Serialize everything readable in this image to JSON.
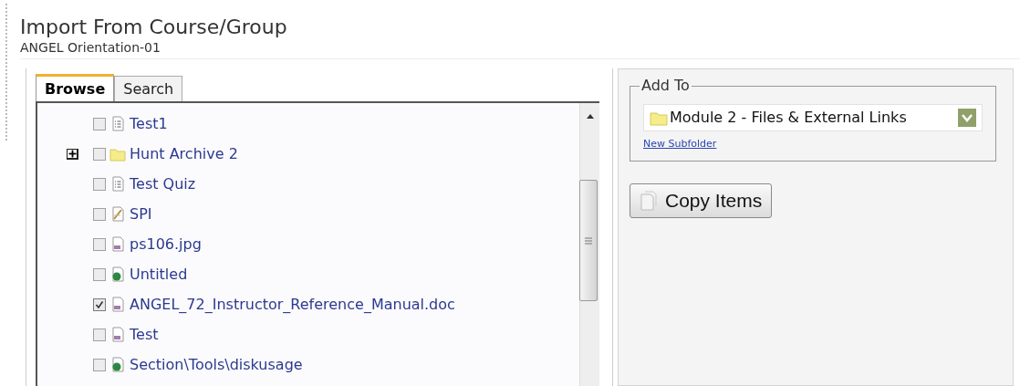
{
  "header": {
    "title": "Import From Course/Group",
    "subtitle": "ANGEL Orientation-01"
  },
  "tabs": [
    {
      "label": "Browse",
      "selected": true
    },
    {
      "label": "Search",
      "selected": false
    }
  ],
  "tree": {
    "items": [
      {
        "label": "Test1",
        "kind": "quiz",
        "checked": false
      },
      {
        "label": "Hunt Archive 2",
        "kind": "folder",
        "checked": false,
        "expanded": false
      },
      {
        "label": "Test Quiz",
        "kind": "quiz",
        "checked": false
      },
      {
        "label": "SPI",
        "kind": "assignment",
        "checked": false
      },
      {
        "label": "ps106.jpg",
        "kind": "file",
        "checked": false
      },
      {
        "label": "Untitled",
        "kind": "web",
        "checked": false
      },
      {
        "label": "ANGEL_72_Instructor_Reference_Manual.doc",
        "kind": "file",
        "checked": true
      },
      {
        "label": "Test",
        "kind": "file",
        "checked": false
      },
      {
        "label": "Section\\Tools\\diskusage",
        "kind": "web",
        "checked": false
      }
    ]
  },
  "add_to": {
    "legend": "Add To",
    "destination": "Module 2 - Files & External Links",
    "link": "New Subfolder"
  },
  "copy_button": "Copy Items"
}
